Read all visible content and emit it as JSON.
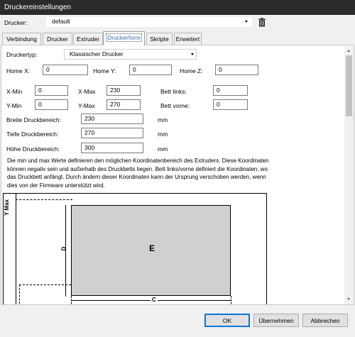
{
  "window": {
    "title": "Druckereinstellungen"
  },
  "printer": {
    "label": "Drucker:",
    "value": "default"
  },
  "tabs": [
    {
      "label": "Verbindung"
    },
    {
      "label": "Drucker"
    },
    {
      "label": "Extruder"
    },
    {
      "label": "Druckerform"
    },
    {
      "label": "Skripte"
    },
    {
      "label": "Erweitert"
    }
  ],
  "form": {
    "printer_type_label": "Druckertyp:",
    "printer_type_value": "Klassischer Drucker",
    "home_x_label": "Home X:",
    "home_x": "0",
    "home_y_label": "Home Y:",
    "home_y": "0",
    "home_z_label": "Home Z:",
    "home_z": "0",
    "xmin_label": "X-Min",
    "xmin": "0",
    "xmax_label": "X-Max",
    "xmax": "230",
    "bed_left_label": "Bett links:",
    "bed_left": "0",
    "ymin_label": "Y-Min",
    "ymin": "0",
    "ymax_label": "Y-Max",
    "ymax": "270",
    "bed_front_label": "Bett vorne:",
    "bed_front": "0",
    "width_label": "Breite Druckbereich:",
    "width": "230",
    "width_unit": "mm",
    "depth_label": "Tiefe Druckbereich:",
    "depth": "270",
    "depth_unit": "mm",
    "height_label": "Höhe Druckbereich:",
    "height": "300",
    "height_unit": "mm",
    "description": "Die min und max Werte definieren den möglichen Koordinatenbereich des Extruders. Diese Koordinaten können negativ sein und außerhalb des Druckbetts liegen. Bett links/vorne definiert die Koordinaten, wo das Druckbett anfängt. Durch ändern dieser Koordinaten kann der Ursprung verschoben werden, wenn dies von der Firmware unterstützt wird."
  },
  "diagram": {
    "ymax_label": "Y Max",
    "bed_label": "E",
    "d_label": "D",
    "c_label": "C"
  },
  "buttons": {
    "ok": "OK",
    "apply": "Übernehmen",
    "cancel": "Abbrechen"
  }
}
